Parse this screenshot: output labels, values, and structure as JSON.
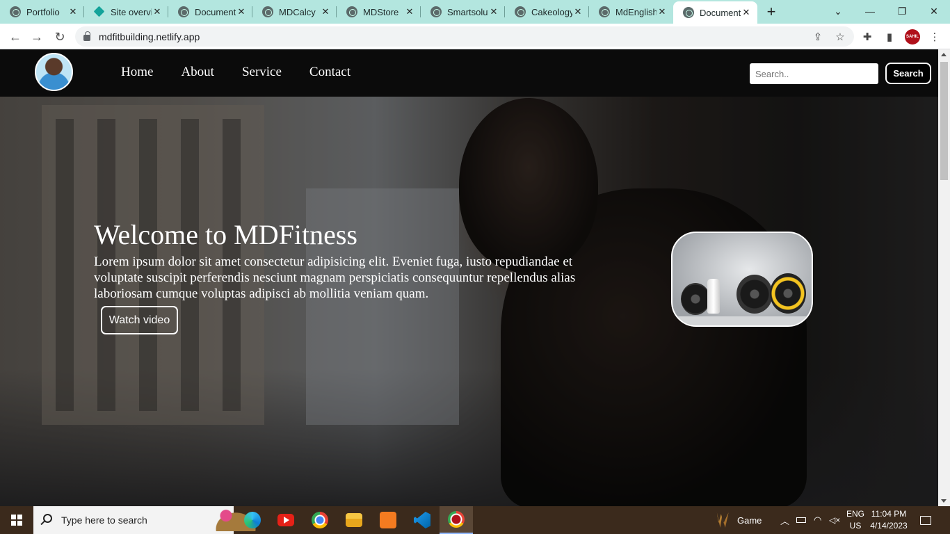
{
  "browser": {
    "tabs": [
      {
        "label": "Portfolio",
        "icon": "globe-icon"
      },
      {
        "label": "Site overvi",
        "icon": "netlify-icon"
      },
      {
        "label": "Document",
        "icon": "globe-icon"
      },
      {
        "label": "MDCalcy",
        "icon": "globe-icon"
      },
      {
        "label": "MDStore",
        "icon": "globe-icon"
      },
      {
        "label": "Smartsolut",
        "icon": "globe-icon"
      },
      {
        "label": "Cakeology",
        "icon": "globe-icon"
      },
      {
        "label": "MdEnglish",
        "icon": "globe-icon"
      },
      {
        "label": "Document",
        "icon": "globe-icon",
        "active": true
      }
    ],
    "url": "mdfitbuilding.netlify.app",
    "profile_label": "SAHIL"
  },
  "site": {
    "nav": [
      "Home",
      "About",
      "Service",
      "Contact"
    ],
    "search_placeholder": "Search..",
    "search_button": "Search",
    "hero_title": "Welcome to MDFitness",
    "hero_description": "Lorem ipsum dolor sit amet consectetur adipisicing elit. Eveniet fuga, iusto repudiandae et voluptate suscipit perferendis nesciunt magnam perspiciatis consequuntur repellendus alias laboriosam cumque voluptas adipisci ab mollitia veniam quam.",
    "watch_button": "Watch video"
  },
  "taskbar": {
    "search_placeholder": "Type here to search",
    "game_label": "Game",
    "lang_top": "ENG",
    "lang_bottom": "US",
    "time": "11:04 PM",
    "date": "4/14/2023"
  },
  "colors": {
    "tabbar": "#b3e6df",
    "navbar": "#0b0b0b",
    "taskbar": "#3b2a1c"
  }
}
